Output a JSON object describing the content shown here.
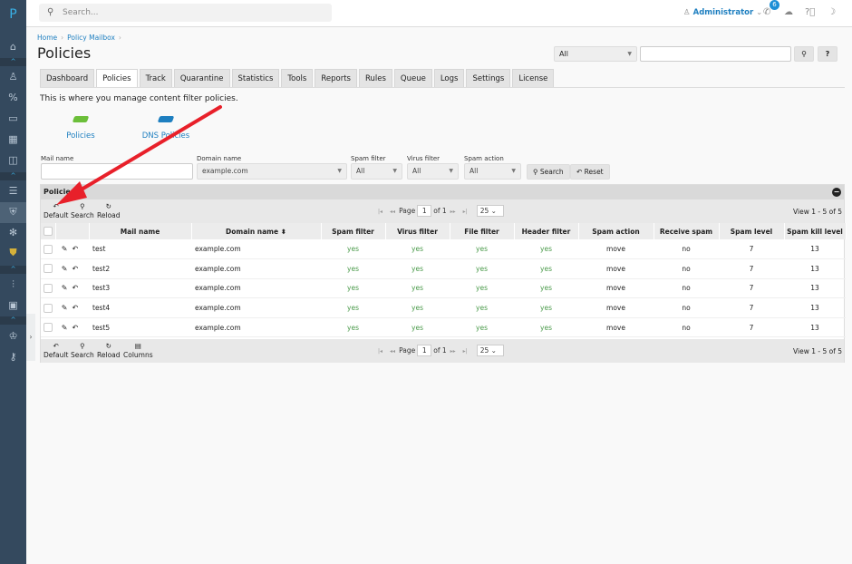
{
  "sidebar": {
    "logo": "P",
    "items": [
      "home-icon",
      "user-icon",
      "percent-icon",
      "monitor-icon",
      "apps-icon",
      "book-icon",
      "checklist-icon",
      "shield-icon",
      "bug-icon",
      "shield-bug-icon",
      "sliders-icon",
      "widgets-icon",
      "crown-icon",
      "key-icon"
    ],
    "active": "shield-icon"
  },
  "topbar": {
    "search_placeholder": "Search...",
    "user": "Administrator",
    "notifications": "6"
  },
  "breadcrumb": [
    "Home",
    "Policy Mailbox"
  ],
  "page_title": "Policies",
  "quick_search": {
    "select": "All",
    "value": "",
    "help": "?"
  },
  "tabs": [
    "Dashboard",
    "Policies",
    "Track",
    "Quarantine",
    "Statistics",
    "Tools",
    "Reports",
    "Rules",
    "Queue",
    "Logs",
    "Settings",
    "License"
  ],
  "active_tab": "Policies",
  "description": "This is where you manage content filter policies.",
  "links": [
    {
      "label": "Policies",
      "color": "#6cbf3a"
    },
    {
      "label": "DNS Policies",
      "color": "#1e7fc0"
    }
  ],
  "filters": {
    "mail_name": {
      "label": "Mail name",
      "value": ""
    },
    "domain_name": {
      "label": "Domain name",
      "value": "example.com"
    },
    "spam_filter": {
      "label": "Spam filter",
      "value": "All"
    },
    "virus_filter": {
      "label": "Virus filter",
      "value": "All"
    },
    "spam_action": {
      "label": "Spam action",
      "value": "All"
    },
    "search": "Search",
    "reset": "Reset"
  },
  "grid": {
    "caption": "Policies",
    "toolbar_top": [
      "Default",
      "Search",
      "Reload"
    ],
    "toolbar_bottom": [
      "Default",
      "Search",
      "Reload",
      "Columns"
    ],
    "pager": {
      "page_label": "Page",
      "page": "1",
      "of": "of 1",
      "page_size": "25",
      "view": "View 1 - 5 of 5"
    },
    "columns": [
      "Mail name",
      "Domain name",
      "Spam filter",
      "Virus filter",
      "File filter",
      "Header filter",
      "Spam action",
      "Receive spam",
      "Spam level",
      "Spam kill level"
    ],
    "sort_column": "Domain name",
    "rows": [
      [
        "test",
        "example.com",
        "yes",
        "yes",
        "yes",
        "yes",
        "move",
        "no",
        "7",
        "13"
      ],
      [
        "test2",
        "example.com",
        "yes",
        "yes",
        "yes",
        "yes",
        "move",
        "no",
        "7",
        "13"
      ],
      [
        "test3",
        "example.com",
        "yes",
        "yes",
        "yes",
        "yes",
        "move",
        "no",
        "7",
        "13"
      ],
      [
        "test4",
        "example.com",
        "yes",
        "yes",
        "yes",
        "yes",
        "move",
        "no",
        "7",
        "13"
      ],
      [
        "test5",
        "example.com",
        "yes",
        "yes",
        "yes",
        "yes",
        "move",
        "no",
        "7",
        "13"
      ]
    ]
  },
  "annotation_color": "#e8202a"
}
